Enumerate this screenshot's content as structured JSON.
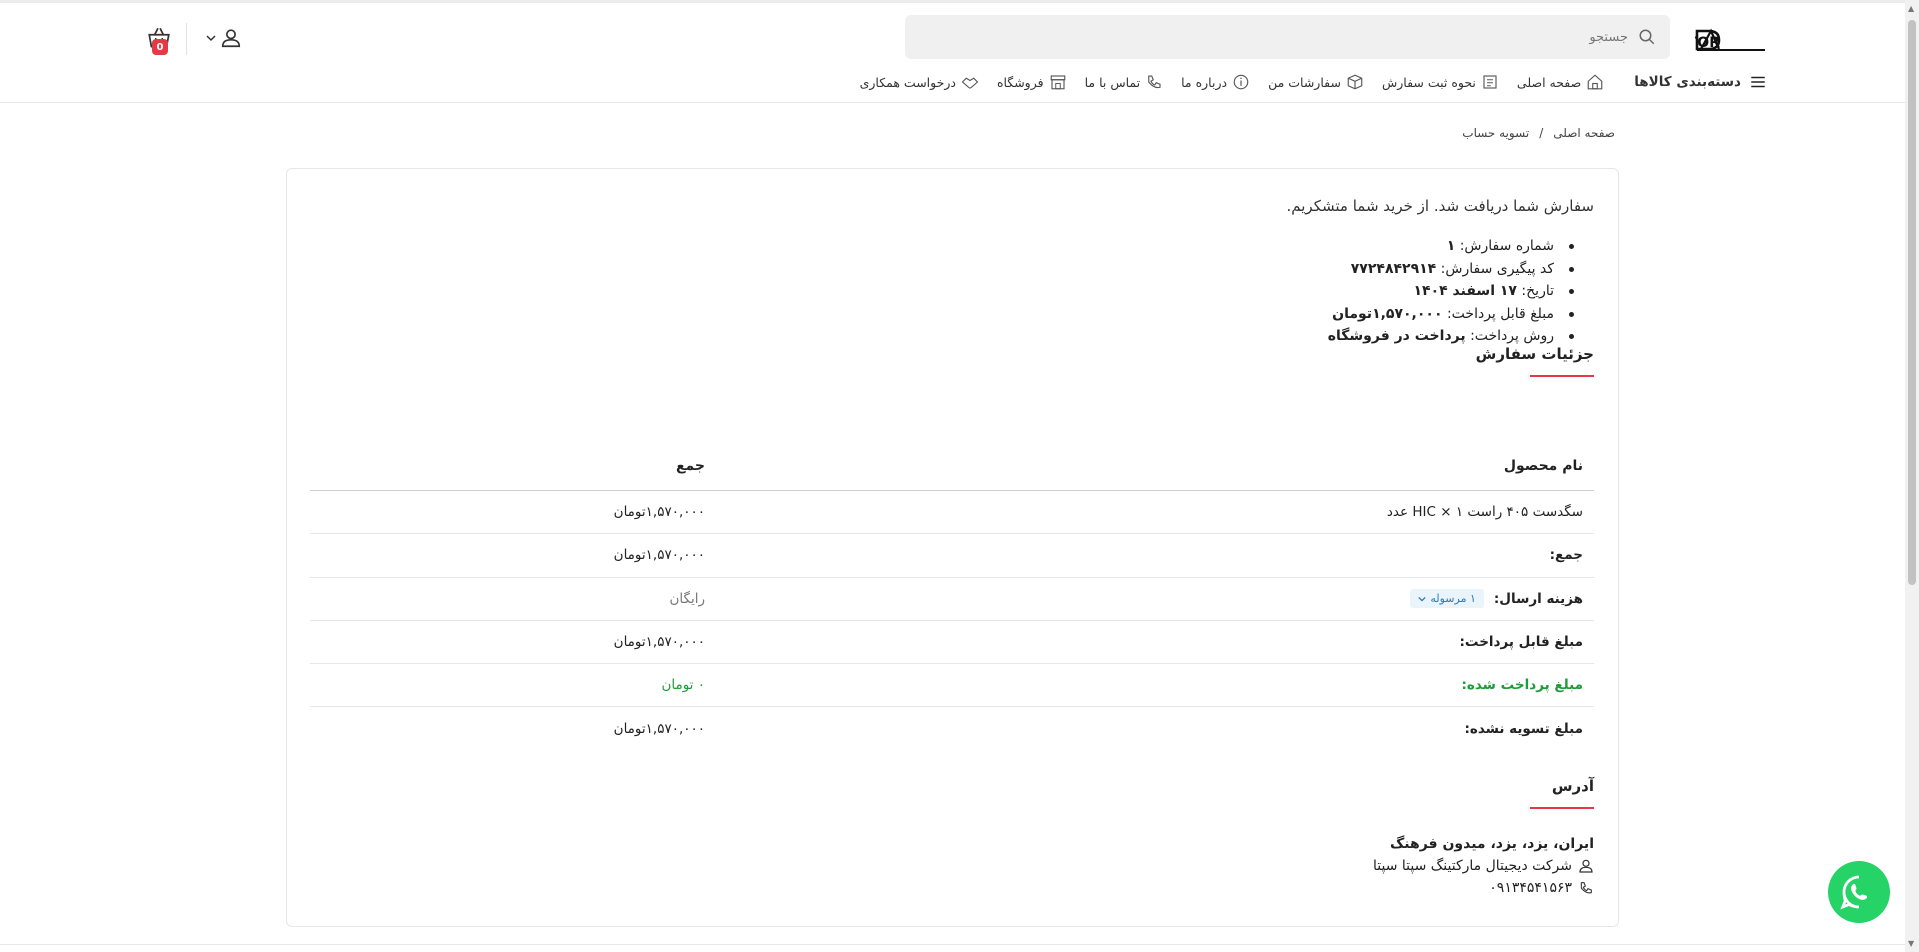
{
  "header": {
    "logo_text": "DAMOTOR",
    "search_placeholder": "جستجو",
    "cart_count": "0"
  },
  "nav": {
    "categories": "دسته‌بندی کالاها",
    "items": [
      {
        "label": "صفحه اصلی",
        "icon": "home-icon"
      },
      {
        "label": "نحوه ثبت سفارش",
        "icon": "order-guide-icon"
      },
      {
        "label": "سفارشات من",
        "icon": "box-icon"
      },
      {
        "label": "درباره ما",
        "icon": "info-icon"
      },
      {
        "label": "تماس با ما",
        "icon": "phone-icon"
      },
      {
        "label": "فروشگاه",
        "icon": "store-icon"
      },
      {
        "label": "درخواست همکاری",
        "icon": "handshake-icon"
      }
    ]
  },
  "breadcrumb": {
    "home": "صفحه اصلی",
    "separator": "/",
    "current": "تسویه حساب"
  },
  "order": {
    "thanks": "سفارش شما دریافت شد. از خرید شما متشکریم.",
    "info": [
      {
        "label": "شماره سفارش:",
        "value": "۱"
      },
      {
        "label": "کد پیگیری سفارش:",
        "value": "۷۷۲۴۸۴۲۹۱۴"
      },
      {
        "label": "تاریخ:",
        "value": "۱۷ اسفند ۱۴۰۴"
      },
      {
        "label": "مبلغ قابل پرداخت:",
        "value": "۱,۵۷۰,۰۰۰تومان"
      },
      {
        "label": "روش پرداخت:",
        "value": "پرداخت در فروشگاه"
      }
    ]
  },
  "details": {
    "title": "جزئیات سفارش",
    "col_product": "نام محصول",
    "col_total": "جمع",
    "product": "سگدست ۴۰۵ راست HIC × ۱ عدد",
    "product_total": "۱,۵۷۰,۰۰۰تومان",
    "subtotal_label": "جمع:",
    "subtotal": "۱,۵۷۰,۰۰۰تومان",
    "shipping_label": "هزینه ارسال:",
    "shipping_badge": "۱ مرسوله",
    "shipping_value": "رایگان",
    "payable_label": "مبلغ قابل پرداخت:",
    "payable": "۱,۵۷۰,۰۰۰تومان",
    "paid_label": "مبلغ پرداخت شده:",
    "paid": "۰ تومان",
    "unpaid_label": "مبلغ تسویه نشده:",
    "unpaid": "۱,۵۷۰,۰۰۰تومان"
  },
  "address": {
    "title": "آدرس",
    "location": "ایران، یزد، یزد، میدون فرهنگ",
    "company": "شرکت دیجیتال مارکتینگ سپتا سپتا",
    "phone": "۰۹۱۳۴۵۴۱۵۶۳"
  },
  "colors": {
    "accent": "#e63946",
    "paid_green": "#1e9b3a",
    "badge_blue": "#2a7bbf",
    "whatsapp": "#25d366"
  }
}
